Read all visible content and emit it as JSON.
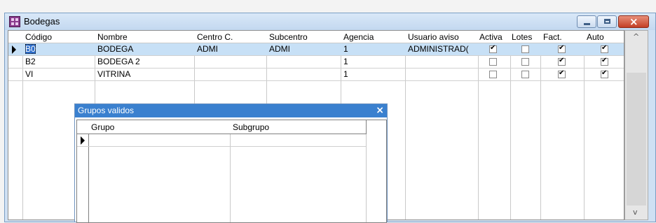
{
  "window": {
    "title": "Bodegas"
  },
  "columns": [
    "Código",
    "Nombre",
    "Centro C.",
    "Subcentro",
    "Agencia",
    "Usuario aviso",
    "Activa",
    "Lotes",
    "Fact.",
    "Auto"
  ],
  "rows": [
    {
      "codigo": "B0",
      "nombre": "BODEGA",
      "centro": "ADMI",
      "subcentro": "ADMI",
      "agencia": "1",
      "usuario": "ADMINISTRAD(",
      "activa": true,
      "lotes": false,
      "fact": true,
      "auto": true
    },
    {
      "codigo": "B2",
      "nombre": "BODEGA 2",
      "centro": "",
      "subcentro": "",
      "agencia": "1",
      "usuario": "",
      "activa": false,
      "lotes": false,
      "fact": true,
      "auto": true
    },
    {
      "codigo": "VI",
      "nombre": "VITRINA",
      "centro": "",
      "subcentro": "",
      "agencia": "1",
      "usuario": "",
      "activa": false,
      "lotes": false,
      "fact": true,
      "auto": true
    }
  ],
  "child": {
    "title": "Grupos validos",
    "columns": [
      "Grupo",
      "Subgrupo"
    ]
  },
  "icons": {
    "close": "×",
    "scroll_up": "^",
    "scroll_down": "v"
  },
  "colors": {
    "selected_row": "#c7e0f6",
    "child_title": "#3a80cf",
    "close_button": "#c33f26"
  }
}
